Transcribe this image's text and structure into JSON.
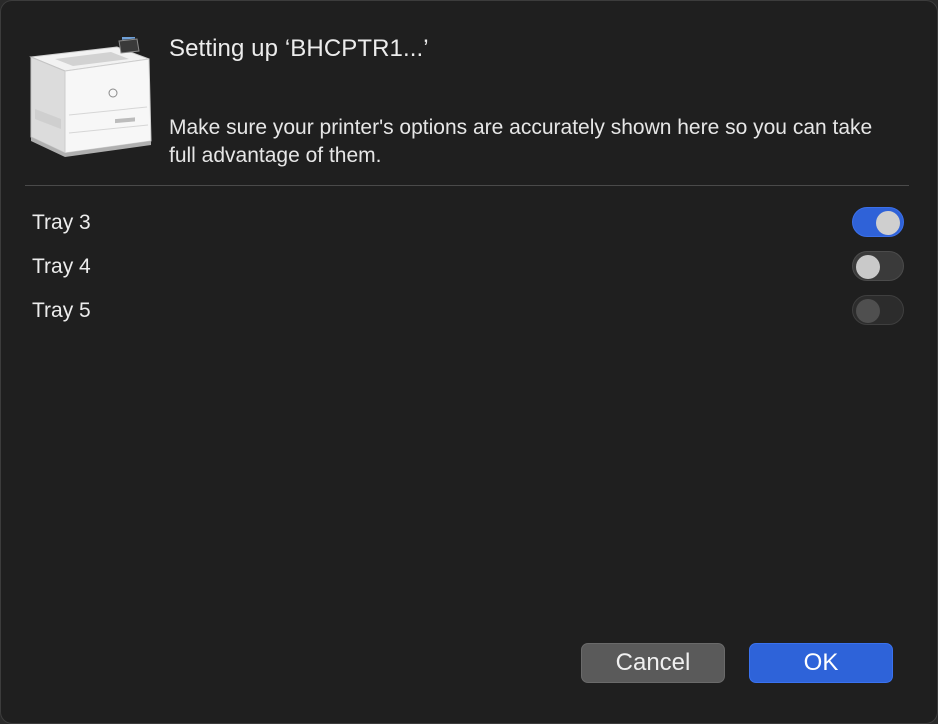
{
  "dialog": {
    "title": "Setting up ‘BHCPTR1...’",
    "description": "Make sure your printer's options are accurately shown here so you can take full advantage of them.",
    "printer_icon": "printer-icon"
  },
  "options": [
    {
      "label": "Tray 3",
      "state": "on"
    },
    {
      "label": "Tray 4",
      "state": "off"
    },
    {
      "label": "Tray 5",
      "state": "disabled"
    }
  ],
  "buttons": {
    "cancel_label": "Cancel",
    "ok_label": "OK"
  },
  "colors": {
    "accent": "#2e63d9",
    "background": "#1f1f1f",
    "cancel_button": "#5a5a5a"
  }
}
